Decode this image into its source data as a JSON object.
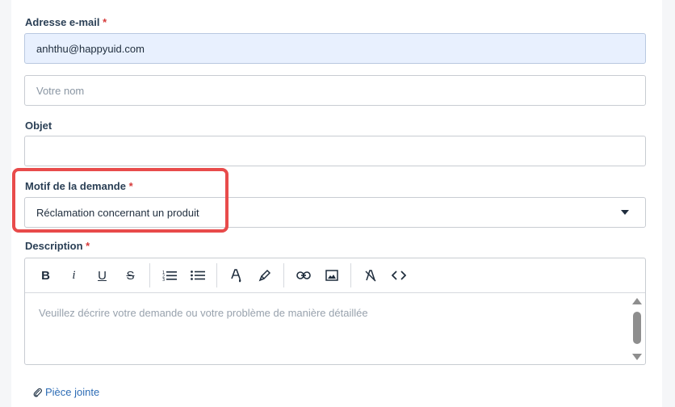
{
  "email": {
    "label": "Adresse e-mail",
    "required": "*",
    "value": "anhthu@happyuid.com"
  },
  "name": {
    "placeholder": "Votre nom"
  },
  "subject": {
    "label": "Objet",
    "value": ""
  },
  "reason": {
    "label": "Motif de la demande",
    "required": "*",
    "selected": "Réclamation concernant un produit"
  },
  "description": {
    "label": "Description",
    "required": "*",
    "placeholder": "Veuillez décrire votre demande ou votre problème de manière détaillée",
    "toolbar": {
      "bold": "B",
      "italic": "i",
      "underline": "U",
      "strike": "S",
      "icons": [
        "bold-icon",
        "italic-icon",
        "underline-icon",
        "strikethrough-icon",
        "ordered-list-icon",
        "bullet-list-icon",
        "text-color-icon",
        "highlight-icon",
        "link-icon",
        "image-icon",
        "clear-format-icon",
        "code-icon"
      ]
    }
  },
  "attachment": {
    "label": "Pièce jointe",
    "icon": "paperclip-icon"
  },
  "colors": {
    "accent": "#2d6cb5",
    "required": "#d63a3a",
    "highlight": "#e84b4b",
    "filled_bg": "#e8f0fe"
  }
}
